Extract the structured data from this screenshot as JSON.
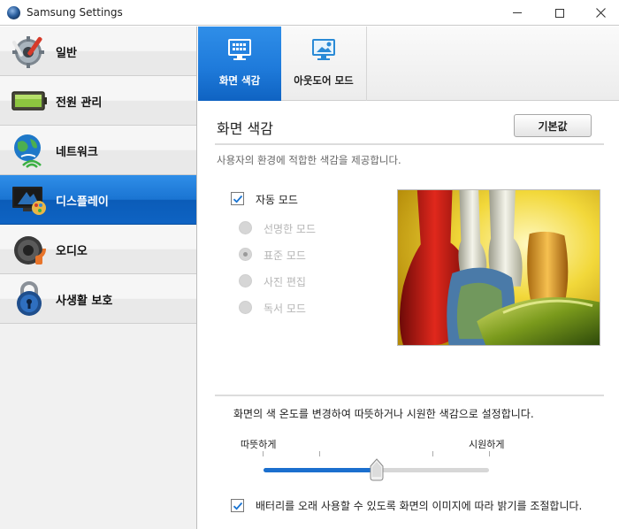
{
  "window": {
    "title": "Samsung Settings"
  },
  "sidebar": {
    "items": [
      {
        "label": "일반",
        "icon": "gear-icon",
        "active": false
      },
      {
        "label": "전원 관리",
        "icon": "battery-icon",
        "active": false
      },
      {
        "label": "네트워크",
        "icon": "globe-wifi-icon",
        "active": false
      },
      {
        "label": "디스플레이",
        "icon": "display-icon",
        "active": true
      },
      {
        "label": "오디오",
        "icon": "speaker-icon",
        "active": false
      },
      {
        "label": "사생활 보호",
        "icon": "lock-icon",
        "active": false
      }
    ]
  },
  "tabs": [
    {
      "label": "화면 색감",
      "icon": "monitor-palette-icon",
      "active": true
    },
    {
      "label": "아웃도어 모드",
      "icon": "monitor-sun-icon",
      "active": false
    }
  ],
  "main": {
    "title": "화면 색감",
    "reset_label": "기본값",
    "description": "사용자의 환경에 적합한 색감을 제공합니다.",
    "auto_mode": {
      "label": "자동 모드",
      "checked": true
    },
    "modes": [
      {
        "label": "선명한 모드",
        "selected": false
      },
      {
        "label": "표준 모드",
        "selected": true
      },
      {
        "label": "사진 편집",
        "selected": false
      },
      {
        "label": "독서 모드",
        "selected": false
      }
    ],
    "temperature": {
      "description": "화면의 색 온도를 변경하여 따뜻하거나 시원한 색감으로 설정합니다.",
      "warm_label": "따뜻하게",
      "cool_label": "시원하게",
      "value": 0.5
    },
    "battery_option": {
      "label": "배터리를 오래 사용할 수 있도록 화면의 이미지에 따라 밝기를 조절합니다.",
      "checked": true
    }
  },
  "colors": {
    "accent": "#1a74d2",
    "accent_dark": "#0b5cb8"
  }
}
